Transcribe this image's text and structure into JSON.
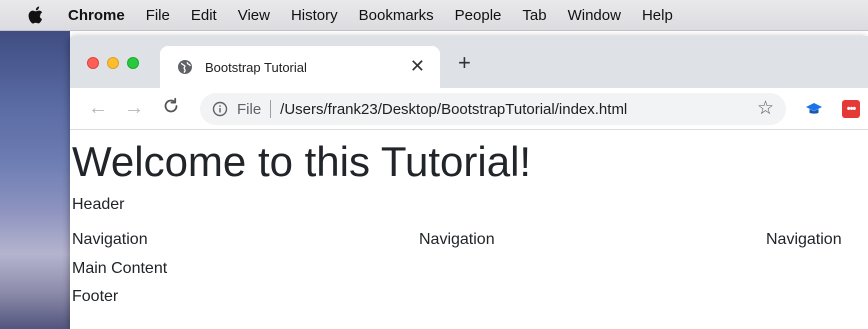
{
  "menubar": {
    "app_name": "Chrome",
    "items": [
      "File",
      "Edit",
      "View",
      "History",
      "Bookmarks",
      "People",
      "Tab",
      "Window",
      "Help"
    ]
  },
  "browser": {
    "tab": {
      "title": "Bootstrap Tutorial"
    },
    "address_bar": {
      "scheme_label": "File",
      "url": "/Users/frank23/Desktop/BootstrapTutorial/index.html"
    },
    "colors": {
      "traffic_red": "#fe5f57",
      "traffic_yellow": "#febc2e",
      "traffic_green": "#28c840",
      "tabstrip_bg": "#dee1e6"
    }
  },
  "page": {
    "heading": "Welcome to this Tutorial!",
    "header_text": "Header",
    "navigation": [
      "Navigation",
      "Navigation",
      "Navigation"
    ],
    "main_content": "Main Content",
    "footer_text": "Footer"
  }
}
